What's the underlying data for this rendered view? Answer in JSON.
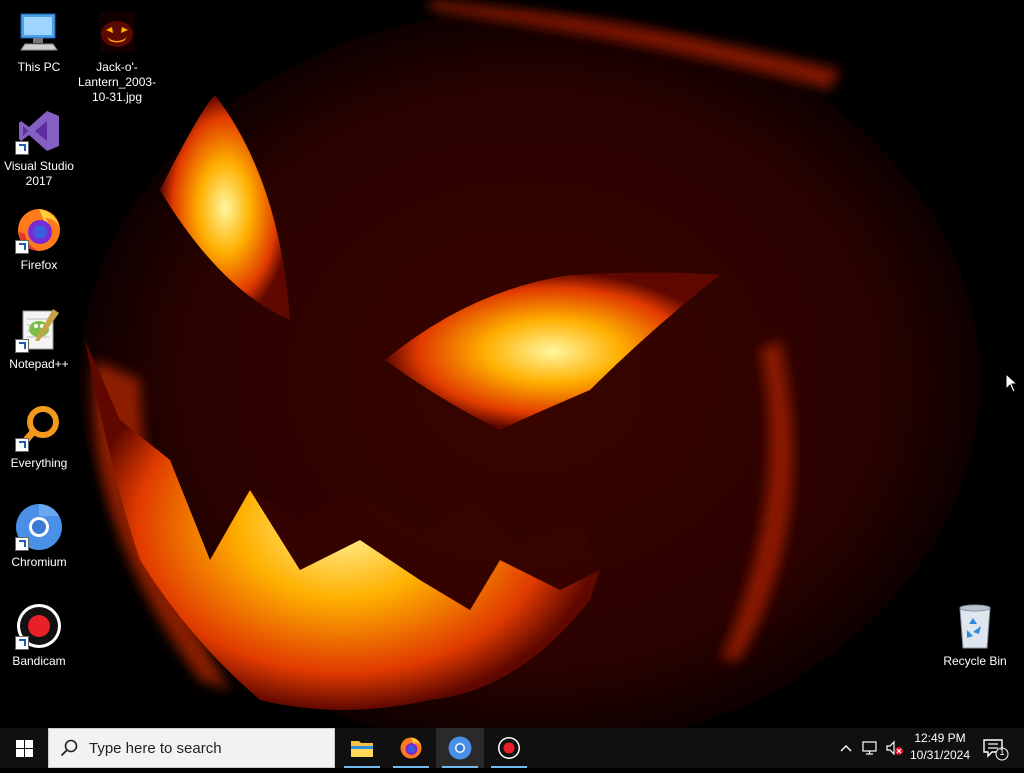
{
  "desktop": {
    "icons": [
      {
        "label": "This PC",
        "icon": "computer-icon"
      },
      {
        "label": "Jack-o'-Lantern_2003-10-31.jpg",
        "icon": "image-file-icon"
      },
      {
        "label": "Visual Studio 2017",
        "icon": "visual-studio-icon"
      },
      {
        "label": "Firefox",
        "icon": "firefox-icon"
      },
      {
        "label": "Notepad++",
        "icon": "notepadpp-icon"
      },
      {
        "label": "Everything",
        "icon": "everything-search-icon"
      },
      {
        "label": "Chromium",
        "icon": "chromium-icon"
      },
      {
        "label": "Bandicam",
        "icon": "bandicam-icon"
      },
      {
        "label": "Recycle Bin",
        "icon": "recycle-bin-icon"
      }
    ],
    "wallpaper": "jack-o-lantern"
  },
  "taskbar": {
    "search_placeholder": "Type here to search",
    "apps": [
      {
        "name": "File Explorer",
        "icon": "folder-icon"
      },
      {
        "name": "Firefox",
        "icon": "firefox-icon"
      },
      {
        "name": "Chromium",
        "icon": "chromium-icon"
      },
      {
        "name": "Bandicam",
        "icon": "bandicam-icon"
      }
    ],
    "clock": {
      "time": "12:49 PM",
      "date": "10/31/2024"
    },
    "notification_count": "1"
  },
  "colors": {
    "taskbar_bg": "#101010",
    "accent": "#76b9ed",
    "flame": "#ffb000"
  }
}
